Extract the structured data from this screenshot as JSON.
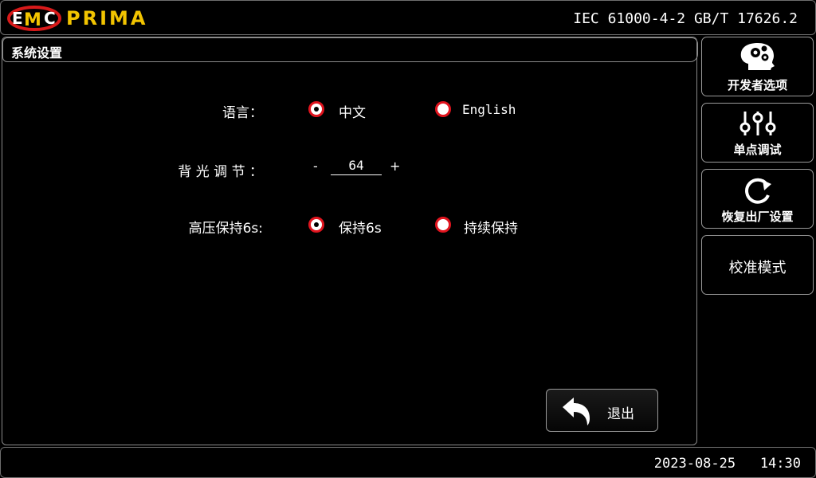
{
  "header": {
    "logo_text": "PRIMA",
    "logo_mark": "EMC",
    "standards": "IEC 61000-4-2  GB/T 17626.2",
    "accent_color": "#f2c400"
  },
  "panel": {
    "title": "系统设置"
  },
  "settings": {
    "language": {
      "label": "语言：",
      "options": [
        "中文",
        "English"
      ],
      "selected": "中文"
    },
    "backlight": {
      "label": "背 光 调 节 ：",
      "minus": "-",
      "value": "64",
      "plus": "+"
    },
    "hv_hold": {
      "label": "高压保持6s:",
      "options": [
        "保持6s",
        "持续保持"
      ],
      "selected": "保持6s"
    }
  },
  "buttons": {
    "exit": "退出",
    "developer": "开发者选项",
    "single_debug": "单点调试",
    "factory_reset": "恢复出厂设置",
    "calibration": "校准模式"
  },
  "icons": {
    "developer": "head-gears-icon",
    "single_debug": "sliders-icon",
    "factory_reset": "refresh-icon",
    "exit": "back-arrow-icon"
  },
  "status": {
    "datetime": "2023-08-25   14:30"
  },
  "colors": {
    "radio_ring": "#e0141e"
  }
}
